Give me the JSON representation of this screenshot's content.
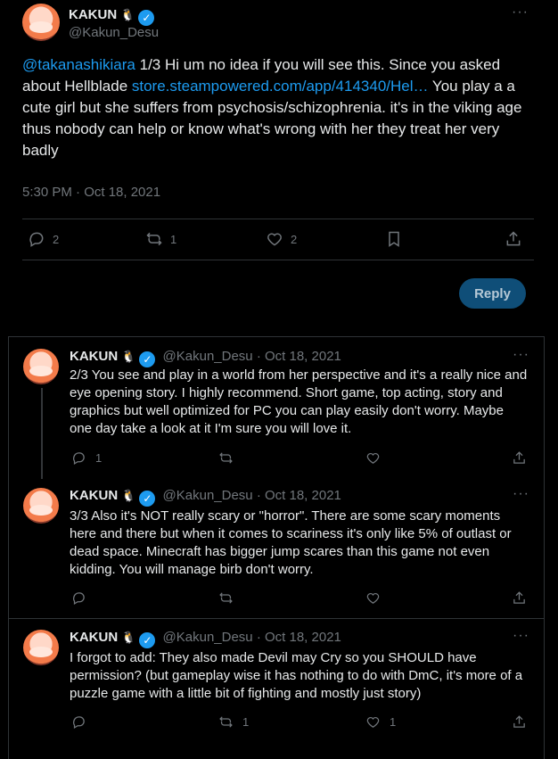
{
  "main": {
    "author": {
      "name": "KAKUN",
      "handle": "@Kakun_Desu",
      "badge_emoji": "🐧"
    },
    "text": {
      "mention": "@takanashikiara",
      "part1": " 1/3 Hi um no idea if you will see this. Since you asked about Hellblade ",
      "link": "store.steampowered.com/app/414340/Hel…",
      "part2": " You play a a cute girl but she suffers from psychosis/schizophrenia. it's in the viking age thus nobody can help or know what's wrong with her they treat her very badly"
    },
    "timestamp": "5:30 PM · Oct 18, 2021",
    "stats": {
      "replies": "2",
      "reposts": "1",
      "likes": "2"
    },
    "reply_button": "Reply"
  },
  "replies": [
    {
      "name": "KAKUN",
      "handle": "@Kakun_Desu",
      "date": "· Oct 18, 2021",
      "text": "2/3 You see and play in a world from her perspective and it's a really nice and eye opening story. I highly recommend. Short game, top acting, story and graphics but well optimized for PC you can play easily don't worry. Maybe one day take a look at it I'm sure you will love it.",
      "replies": "1",
      "reposts": "",
      "likes": ""
    },
    {
      "name": "KAKUN",
      "handle": "@Kakun_Desu",
      "date": "· Oct 18, 2021",
      "text": "3/3 Also it's NOT really scary or \"horror\". There are some scary moments here and there but when it comes to scariness it's only like 5% of outlast or dead space. Minecraft has bigger jump scares than this game not even kidding. You will manage birb don't worry.",
      "replies": "",
      "reposts": "",
      "likes": ""
    },
    {
      "name": "KAKUN",
      "handle": "@Kakun_Desu",
      "date": "· Oct 18, 2021",
      "text": "I forgot to add: They also made Devil may Cry so you SHOULD have permission? (but gameplay wise it has nothing to do with DmC, it's more of a puzzle game with a little bit of fighting and mostly just story)",
      "replies": "",
      "reposts": "1",
      "likes": "1"
    }
  ],
  "colors": {
    "accent": "#1d9bf0",
    "muted": "#71767b",
    "text": "#e7e9ea",
    "divider": "#2f3336"
  }
}
